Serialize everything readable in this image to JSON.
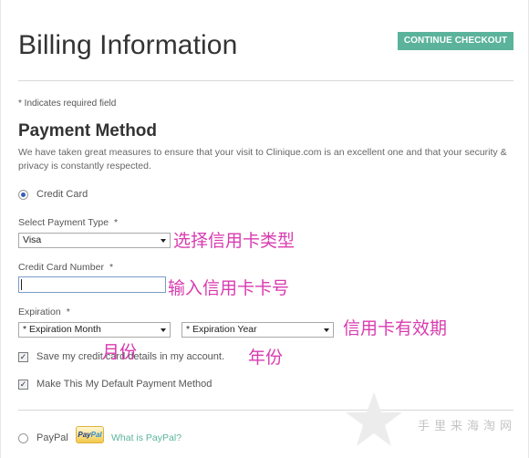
{
  "header": {
    "title": "Billing Information",
    "continue_label": "CONTINUE CHECKOUT"
  },
  "required_note": "* Indicates required field",
  "payment_method": {
    "title": "Payment Method",
    "intro": "We have taken great measures to ensure that your visit to Clinique.com is an excellent one and that your security & privacy is constantly respected.",
    "credit_card_label": "Credit Card",
    "credit_card_selected": true,
    "payment_type": {
      "label": "Select Payment Type",
      "required_mark": "*",
      "selected": "Visa"
    },
    "card_number": {
      "label": "Credit Card Number",
      "required_mark": "*",
      "value": ""
    },
    "expiration": {
      "label": "Expiration",
      "required_mark": "*",
      "month_selected": "* Expiration Month",
      "year_selected": "* Expiration Year"
    },
    "save_details": {
      "label": "Save my credit card details in my account.",
      "checked": true
    },
    "default_method": {
      "label": "Make This My Default Payment Method",
      "checked": true
    }
  },
  "paypal": {
    "label": "PayPal",
    "selected": false,
    "logo_text_a": "Pay",
    "logo_text_b": "Pal",
    "what_is_link": "What is PayPal?"
  },
  "annotations": {
    "payment_type": "选择信用卡类型",
    "card_number": "输入信用卡卡号",
    "expiration": "信用卡有效期",
    "month": "月份",
    "year": "年份"
  },
  "watermark": {
    "text": "手里来海淘网"
  },
  "colors": {
    "accent": "#5bb39b",
    "annotation": "#d93bb0",
    "radio_selected": "#3a5cb8"
  }
}
